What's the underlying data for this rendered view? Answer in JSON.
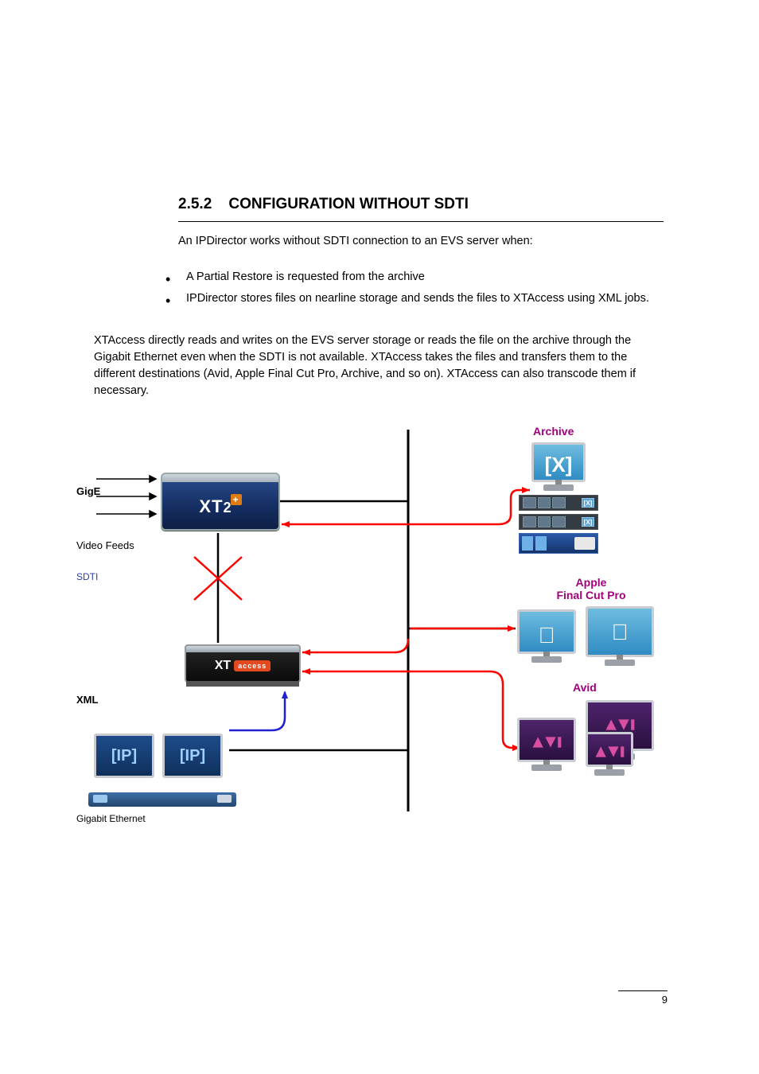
{
  "header": {
    "title": "2.5.2",
    "subtitle": "CONFIGURATION WITHOUT SDTI",
    "intro": "An IPDirector works without SDTI connection to an EVS server when:"
  },
  "bullets": {
    "items": [
      "A Partial Restore is requested from the archive",
      "IPDirector stores files on nearline storage and sends the files to XTAccess using XML jobs."
    ]
  },
  "para": "XTAccess directly reads and writes on the EVS server storage or reads the file on the archive through the Gigabit Ethernet even when the SDTI is not available. XTAccess takes the files and transfers them to the different destinations (Avid, Apple Final Cut Pro, Archive, and so on). XTAccess can also transcode them if necessary.",
  "diagram": {
    "videoFeeds": "Video Feeds",
    "gige": "GigE",
    "sdti": "SDTI",
    "xml": "XML",
    "gigabit": "Gigabit Ethernet",
    "xt2": "XT",
    "xt2suffix": "2",
    "xtaccess": "XT",
    "xtaccess_sub": "access",
    "ip": "[IP]",
    "x": "[X]",
    "archive": "Archive",
    "apple_l1": "Apple",
    "apple_l2": "Final Cut Pro",
    "avid": "Avid"
  },
  "footer": {
    "page": "9"
  }
}
